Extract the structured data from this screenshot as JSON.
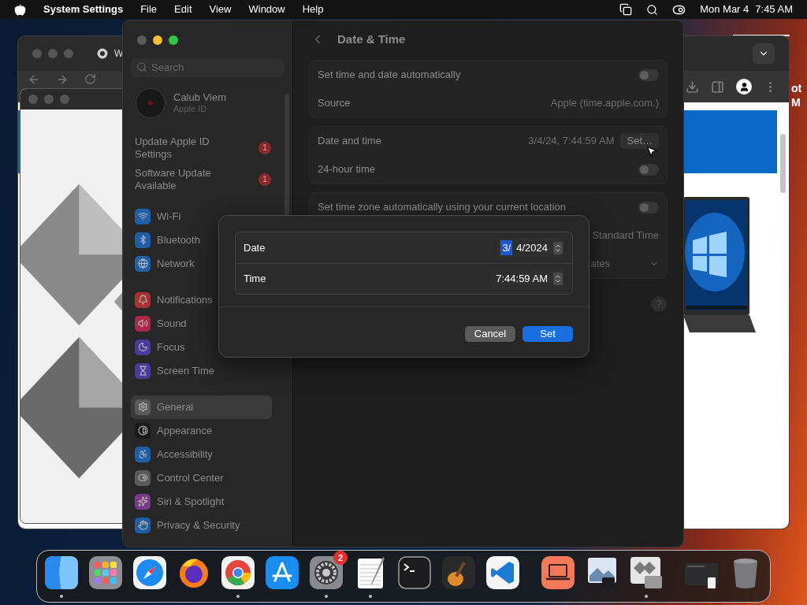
{
  "menu_bar": {
    "app": "System Settings",
    "menus": [
      "File",
      "Edit",
      "View",
      "Window",
      "Help"
    ],
    "date": "Mon Mar 4",
    "time": "7:45 AM"
  },
  "browser_window": {
    "tab_title": "W"
  },
  "desktop_label": [
    "ot",
    "M"
  ],
  "settings": {
    "title": "Date & Time",
    "search": {
      "placeholder": "Search"
    },
    "account": {
      "name": "Calub Viem",
      "subtitle": "Apple ID"
    },
    "notices": [
      {
        "label": "Update Apple ID Settings",
        "badge": "1"
      },
      {
        "label": "Software Update Available",
        "badge": "1"
      }
    ],
    "sidebar_groups": [
      [
        {
          "label": "Wi-Fi",
          "color": "#1f5fa8",
          "selected": false
        },
        {
          "label": "Bluetooth",
          "color": "#1f5fa8",
          "selected": false
        },
        {
          "label": "Network",
          "color": "#1f5fa8",
          "selected": false
        }
      ],
      [
        {
          "label": "Notifications",
          "color": "#a83232",
          "selected": false
        },
        {
          "label": "Sound",
          "color": "#a8284a",
          "selected": false
        },
        {
          "label": "Focus",
          "color": "#4a3a9a",
          "selected": false
        },
        {
          "label": "Screen Time",
          "color": "#4a3a9a",
          "selected": false
        }
      ],
      [
        {
          "label": "General",
          "color": "#5a5a5a",
          "selected": true
        },
        {
          "label": "Appearance",
          "color": "#1a1a1a",
          "selected": false
        },
        {
          "label": "Accessibility",
          "color": "#1f5fa8",
          "selected": false
        },
        {
          "label": "Control Center",
          "color": "#5a5a5a",
          "selected": false
        },
        {
          "label": "Siri & Spotlight",
          "color": "#7a3a8a",
          "selected": false
        },
        {
          "label": "Privacy & Security",
          "color": "#1f5fa8",
          "selected": false
        }
      ]
    ],
    "groups": [
      [
        {
          "kind": "toggle",
          "label": "Set time and date automatically",
          "on": false
        },
        {
          "kind": "value",
          "label": "Source",
          "value": "Apple (time.apple.com.)"
        }
      ],
      [
        {
          "kind": "datetime",
          "label": "Date and time",
          "value": "3/4/24, 7:44:59 AM",
          "button": "Set…"
        },
        {
          "kind": "toggle",
          "label": "24-hour time",
          "on": false
        }
      ],
      [
        {
          "kind": "toggle",
          "label": "Set time zone automatically using your current location",
          "on": false
        },
        {
          "kind": "value",
          "value": "Standard Time"
        },
        {
          "kind": "select",
          "value": "ates"
        }
      ]
    ],
    "help_button": "?"
  },
  "dialog": {
    "fields": [
      {
        "label": "Date",
        "segments": [
          {
            "text": "3/",
            "selected": true
          },
          {
            "text": "4/2024",
            "selected": false
          }
        ]
      },
      {
        "label": "Time",
        "segments": [
          {
            "text": "7:44:59 AM",
            "selected": false
          }
        ]
      }
    ],
    "buttons": [
      {
        "label": "Cancel",
        "kind": "secondary"
      },
      {
        "label": "Set",
        "kind": "primary"
      }
    ]
  },
  "dock": {
    "apps": [
      {
        "running": true
      },
      {
        "running": false
      },
      {
        "running": false
      },
      {
        "running": false
      },
      {
        "running": true
      },
      {
        "running": false
      },
      {
        "running": true,
        "badge": "2"
      },
      {
        "running": true
      },
      {
        "running": false
      },
      {
        "running": false
      },
      {
        "running": false
      }
    ],
    "recent": [
      {
        "running": false
      },
      {
        "running": false
      },
      {
        "running": true
      }
    ],
    "stacks": [
      {
        "running": false
      },
      {
        "running": false
      }
    ]
  }
}
